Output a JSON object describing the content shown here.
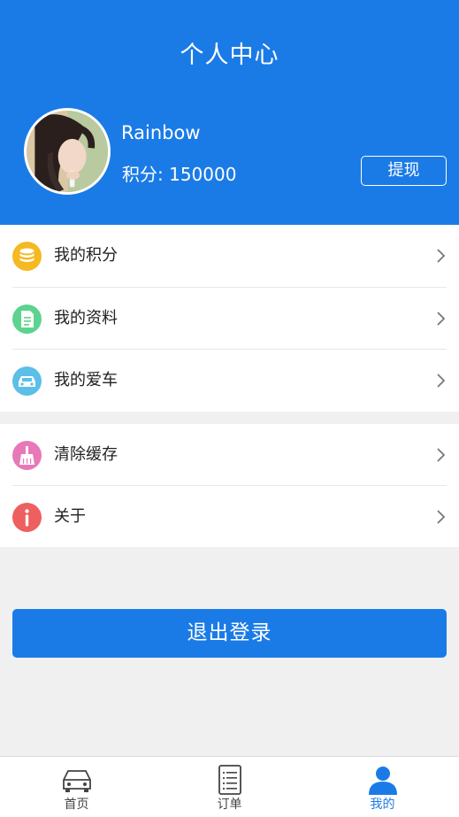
{
  "header": {
    "title": "个人中心",
    "username": "Rainbow",
    "points_text": "积分: 150000",
    "withdraw_label": "提现"
  },
  "menu_group_1": [
    {
      "label": "我的积分",
      "icon": "coins-icon",
      "icon_color": "#f5b921"
    },
    {
      "label": "我的资料",
      "icon": "document-icon",
      "icon_color": "#5cd38f"
    },
    {
      "label": "我的爱车",
      "icon": "car-icon",
      "icon_color": "#5bbfe8"
    }
  ],
  "menu_group_2": [
    {
      "label": "清除缓存",
      "icon": "broom-icon",
      "icon_color": "#e879b8"
    },
    {
      "label": "关于",
      "icon": "info-icon",
      "icon_color": "#ee5f5f"
    }
  ],
  "logout_label": "退出登录",
  "tabbar": [
    {
      "label": "首页",
      "icon": "car-outline-icon",
      "active": false
    },
    {
      "label": "订单",
      "icon": "list-icon",
      "active": false
    },
    {
      "label": "我的",
      "icon": "person-icon",
      "active": true
    }
  ],
  "colors": {
    "primary": "#1b7be6",
    "background": "#f0f0f0"
  }
}
